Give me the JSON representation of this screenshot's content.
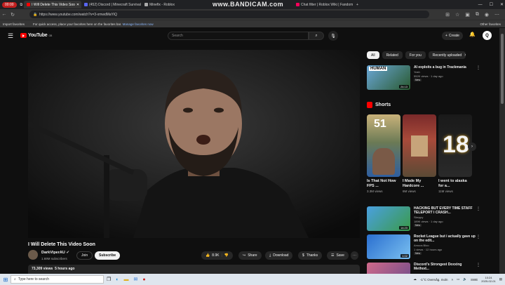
{
  "browser": {
    "recording_badge": "00:00",
    "tabs": [
      {
        "label": "I Will Delete This Video Soo",
        "active": true,
        "color": "#ff0000"
      },
      {
        "label": "(452) Discord | Minecraft Survival",
        "active": false,
        "color": "#5865f2"
      },
      {
        "label": "Minefix - Roblox",
        "active": false,
        "color": "#999999"
      },
      {
        "label": "Chat filter | Roblox Wiki | Fandom",
        "active": false,
        "color": "#f0a"
      }
    ],
    "watermark": "www.BANDICAM.com",
    "url": "https://www.youtube.com/watch?v=3-xmwdMaYiQ",
    "favorites_bar": {
      "import": "Import favorites",
      "hint": "For quick access, place your favorites here on the favorites bar.",
      "manage_link": "Manage favorites now",
      "other": "Other favorites"
    }
  },
  "header": {
    "logo": "YouTube",
    "logo_region": "GB",
    "search_placeholder": "Search",
    "create_label": "Create",
    "avatar_letter": "Q"
  },
  "video": {
    "title": "I Will Delete This Video Soon",
    "channel": "DarkViperAU",
    "subscribers": "1.69M subscribers",
    "join_label": "Join",
    "subscribe_label": "Subscribe",
    "likes": "8.9K",
    "share_label": "Share",
    "download_label": "Download",
    "thanks_label": "Thanks",
    "save_label": "Save",
    "views": "73,309 views",
    "posted": "5 hours ago"
  },
  "chips": [
    "All",
    "Related",
    "For you",
    "Recently uploaded"
  ],
  "recommended_top": {
    "title": "AI exploits a bug in Trackmania",
    "channel": "Yosh",
    "meta": "552K views · 1 day ago",
    "badge": "New",
    "duration": "24:13",
    "thumb_text": "HUMAN"
  },
  "shorts": {
    "heading": "Shorts",
    "items": [
      {
        "title": "Is That Not How FPS ...",
        "views": "3.3M views",
        "thumb_text": "51"
      },
      {
        "title": "I Made My Hardcore ...",
        "views": "6M views",
        "thumb_text": ""
      },
      {
        "title": "I went to alaska for a...",
        "views": "11M views",
        "thumb_text": "18"
      }
    ]
  },
  "recommended": [
    {
      "title": "HACKING BUT EVERY TIME STAFF TELEPORT I CRASH...",
      "channel": "Skeppy",
      "meta": "189K views · 1 day ago",
      "badge": "New",
      "duration": "14:23"
    },
    {
      "title": "Rocket League but i actually gave up on the edit...",
      "channel": "Amoos Bloo",
      "meta": "1 views · 12 hours ago",
      "badge": "New",
      "duration": "1:02"
    },
    {
      "title": "Discord's Strongest Doxxing Method...",
      "channel": "",
      "meta": "",
      "badge": "",
      "duration": ""
    }
  ],
  "taskbar": {
    "search_placeholder": "Type here to search",
    "weather": "-1°C  Overvåg. moln",
    "lang": "SWE",
    "time": "10:24",
    "date": "2025-02-01"
  }
}
